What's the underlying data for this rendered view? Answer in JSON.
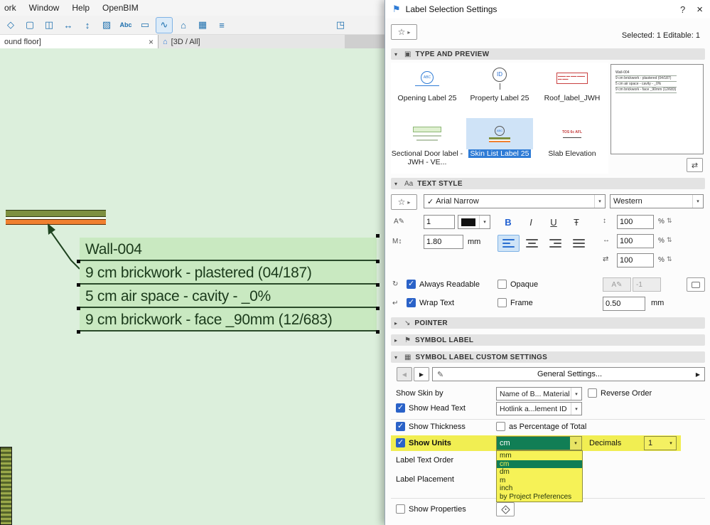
{
  "glyphs": {
    "chevron_down": "▾",
    "tri_open": "▾",
    "tri_closed": "▸",
    "star": "☆",
    "fly": "▸",
    "left": "◀",
    "right": "▶",
    "close": "×",
    "help": "?",
    "check": "✓",
    "x_small": "×",
    "house": "⌂",
    "flag": "⚑",
    "pen": "✎",
    "stepper": "⇅",
    "transfer": "⇄",
    "pointer_icon": "↘",
    "type_icon": "▣",
    "textstyle_icon": "Aa",
    "symbol_icon": "⚑",
    "custom_icon": "▦",
    "wrap_icon": "↵",
    "readable_icon": "↻",
    "mheight_icon": "M↕",
    "pen_a_icon": "A✎",
    "linespacing_icon": "↕",
    "widthfactor_icon": "↔",
    "tracking_icon": "⇄",
    "gs_icon": "✎"
  },
  "menubar": {
    "items": [
      "ork",
      "Window",
      "Help",
      "OpenBIM"
    ]
  },
  "toolbar": {
    "icons": [
      {
        "name": "marquee-diamond-icon",
        "glyph": "◇"
      },
      {
        "name": "virtual-trace-icon",
        "glyph": "▢"
      },
      {
        "name": "split-window-icon",
        "glyph": "◫"
      },
      {
        "name": "fit-width-icon",
        "glyph": "↔"
      },
      {
        "name": "pan-icon",
        "glyph": "↕"
      },
      {
        "name": "hatch-icon",
        "glyph": "▨"
      },
      {
        "name": "text-tool-icon",
        "glyph": "Abc"
      },
      {
        "name": "detail-icon",
        "glyph": "▭"
      },
      {
        "name": "spline-tool-icon",
        "glyph": "∿"
      },
      {
        "name": "roof-tool-icon",
        "glyph": "⌂"
      },
      {
        "name": "grid-icon",
        "glyph": "▦"
      },
      {
        "name": "layers-icon",
        "glyph": "≡"
      }
    ],
    "right_icon": {
      "name": "axonometry-icon",
      "glyph": "◳"
    }
  },
  "tabs": {
    "active": "ound floor]",
    "second": "[3D / All]"
  },
  "canvas": {
    "label_title": "Wall-004",
    "label_rows": [
      "9 cm  brickwork - plastered (04/187)",
      "5 cm  air space - cavity - _0%",
      "9 cm  brickwork - face _90mm (12/683)"
    ]
  },
  "dialog": {
    "title": "Label Selection Settings",
    "selected_info": "Selected: 1 Editable: 1",
    "type_section": {
      "title": "TYPE AND PREVIEW",
      "items": [
        {
          "label": "Opening Label 25"
        },
        {
          "label": "Property Label 25"
        },
        {
          "label": "Roof_label_JWH"
        },
        {
          "label": "Sectional Door label - JWH - VE..."
        },
        {
          "label": "Skin List Label 25"
        },
        {
          "label": "Slab Elevation"
        }
      ],
      "icon_texts": {
        "opening": "ABC",
        "property": "ID",
        "skin": "ABC",
        "slab": "TOS 6c AFL"
      },
      "preview_lines": [
        "Wall-004",
        "9 cm  brickwork - plastered (04/187)",
        "5 cm  air space - cavity - _0%",
        "9 cm  brickwork - face _90mm (12/683)"
      ]
    },
    "text_style": {
      "title": "TEXT STYLE",
      "font_check": "✓",
      "font_name": "Arial Narrow",
      "encoding": "Western",
      "font_size": "1",
      "bold": "B",
      "italic": "I",
      "underline": "U",
      "strikethrough": "Ŧ",
      "percents": [
        "100",
        "100",
        "100"
      ],
      "percent_sign": "%",
      "row_height": "1.80",
      "mm": "mm",
      "always_readable": "Always Readable",
      "opaque": "Opaque",
      "wrap_text": "Wrap Text",
      "frame": "Frame",
      "pen_offset": "-1",
      "frame_offset": "0.50"
    },
    "pointer_title": "POINTER",
    "symbol_label_title": "SYMBOL LABEL",
    "custom_title": "SYMBOL LABEL CUSTOM SETTINGS",
    "custom": {
      "general_settings": "General Settings...",
      "show_skin_by": "Show Skin by",
      "skin_by_value": "Name of B... Material",
      "reverse_order": "Reverse Order",
      "show_head_text": "Show Head Text",
      "head_text_value": "Hotlink a...lement ID",
      "show_thickness": "Show Thickness",
      "as_percentage": "as Percentage of Total",
      "show_units": "Show Units",
      "units_value": "cm",
      "decimals_label": "Decimals",
      "decimals_value": "1",
      "units_options": [
        "mm",
        "cm",
        "dm",
        "m",
        "inch",
        "by Project Preferences"
      ],
      "label_text_order": "Label Text Order",
      "label_placement": "Label Placement",
      "show_properties": "Show Properties"
    }
  },
  "colors": {
    "accent_blue": "#2f7cd6",
    "highlight_yellow": "#f1ee52",
    "selected_green": "#117e55",
    "canvas_green": "#dcefdc"
  }
}
